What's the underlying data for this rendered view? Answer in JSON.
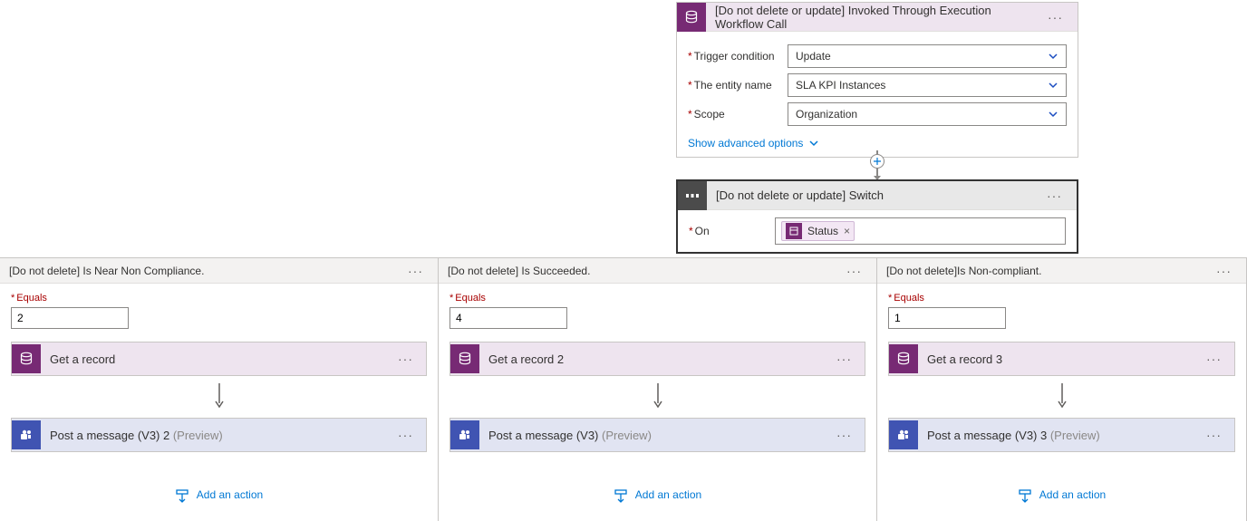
{
  "trigger": {
    "title": "[Do not delete or update] Invoked Through Execution Workflow Call",
    "fields": {
      "trigger_condition": {
        "label": "Trigger condition",
        "value": "Update"
      },
      "entity_name": {
        "label": "The entity name",
        "value": "SLA KPI Instances"
      },
      "scope": {
        "label": "Scope",
        "value": "Organization"
      }
    },
    "advanced_link": "Show advanced options"
  },
  "switch": {
    "title": "[Do not delete or update] Switch",
    "on_label": "On",
    "token": "Status"
  },
  "cases": [
    {
      "title": "[Do not delete] Is Near Non Compliance.",
      "equals_label": "Equals",
      "equals_value": "2",
      "actions": [
        {
          "kind": "record",
          "label": "Get a record"
        },
        {
          "kind": "post",
          "label": "Post a message (V3) 2 ",
          "preview": "(Preview)"
        }
      ],
      "add_action": "Add an action"
    },
    {
      "title": "[Do not delete] Is Succeeded.",
      "equals_label": "Equals",
      "equals_value": "4",
      "actions": [
        {
          "kind": "record",
          "label": "Get a record 2"
        },
        {
          "kind": "post",
          "label": "Post a message (V3) ",
          "preview": "(Preview)"
        }
      ],
      "add_action": "Add an action"
    },
    {
      "title": "[Do not delete]Is Non-compliant.",
      "equals_label": "Equals",
      "equals_value": "1",
      "actions": [
        {
          "kind": "record",
          "label": "Get a record 3"
        },
        {
          "kind": "post",
          "label": "Post a message (V3) 3 ",
          "preview": "(Preview)"
        }
      ],
      "add_action": "Add an action"
    }
  ]
}
